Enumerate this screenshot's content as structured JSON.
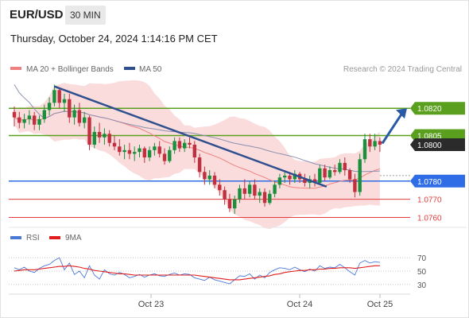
{
  "header": {
    "symbol": "EUR/USD",
    "timeframe": "30 MIN",
    "datetime": "Thursday, October 24, 2024 1:14:16 PM CET"
  },
  "legend": {
    "ma20_bb": "MA 20 + Bollinger Bands",
    "ma50": "MA 50",
    "credit": "Research © 2024 Trading Central"
  },
  "rsi_legend": {
    "rsi": "RSI",
    "ma9": "9MA"
  },
  "colors": {
    "support_resistance_green": "#5aa01e",
    "pivot_blue": "#2e6de6",
    "target_red": "#e03c3c",
    "candle_up": "#1a8f3c",
    "candle_down": "#c0303e",
    "ma50": "#2f4f8f",
    "bollinger": "#f5c0c0",
    "rsi_line": "#4a78d8",
    "rsi_ma": "#e01e1e",
    "arrow": "#2a5aa6"
  },
  "chart_data": {
    "type": "candlestick",
    "title": "EUR/USD",
    "timeframe": "30 MIN",
    "price_scale": {
      "min": 1.0755,
      "max": 1.0838
    },
    "x_ticks": [
      "Oct 23",
      "Oct 24",
      "Oct 25"
    ],
    "levels": [
      {
        "value": 1.082,
        "label": "1.0820",
        "kind": "resistance",
        "color": "#5aa01e"
      },
      {
        "value": 1.0805,
        "label": "1.0805",
        "kind": "resistance",
        "color": "#5aa01e"
      },
      {
        "value": 1.08,
        "label": "1.0800",
        "kind": "last_price",
        "color": "#2b2b2b"
      },
      {
        "value": 1.078,
        "label": "1.0780",
        "kind": "pivot",
        "color": "#2e6de6"
      },
      {
        "value": 1.077,
        "label": "1.0770",
        "kind": "support",
        "color": "#e03c3c"
      },
      {
        "value": 1.076,
        "label": "1.0760",
        "kind": "support",
        "color": "#e03c3c"
      }
    ],
    "candles": [
      [
        1.0818,
        1.0821,
        1.081,
        1.0815
      ],
      [
        1.0815,
        1.0818,
        1.0809,
        1.0812
      ],
      [
        1.0812,
        1.0817,
        1.0809,
        1.0814
      ],
      [
        1.0814,
        1.0819,
        1.0811,
        1.0816
      ],
      [
        1.0816,
        1.0818,
        1.0808,
        1.0811
      ],
      [
        1.0811,
        1.0816,
        1.0808,
        1.0814
      ],
      [
        1.0814,
        1.0822,
        1.0812,
        1.0819
      ],
      [
        1.0819,
        1.0826,
        1.0816,
        1.0823
      ],
      [
        1.0823,
        1.0833,
        1.0821,
        1.083
      ],
      [
        1.083,
        1.0831,
        1.082,
        1.0823
      ],
      [
        1.0823,
        1.0828,
        1.0818,
        1.0825
      ],
      [
        1.0825,
        1.0828,
        1.0812,
        1.0815
      ],
      [
        1.0815,
        1.0822,
        1.0811,
        1.0819
      ],
      [
        1.0819,
        1.0823,
        1.081,
        1.0812
      ],
      [
        1.0812,
        1.0818,
        1.0809,
        1.0815
      ],
      [
        1.0815,
        1.0816,
        1.0797,
        1.08
      ],
      [
        1.08,
        1.081,
        1.0798,
        1.0807
      ],
      [
        1.0807,
        1.0812,
        1.0801,
        1.0804
      ],
      [
        1.0804,
        1.0809,
        1.08,
        1.0806
      ],
      [
        1.0806,
        1.0808,
        1.0799,
        1.0801
      ],
      [
        1.0801,
        1.0805,
        1.0797,
        1.0799
      ],
      [
        1.0799,
        1.0803,
        1.0794,
        1.0796
      ],
      [
        1.0796,
        1.08,
        1.0792,
        1.0797
      ],
      [
        1.0797,
        1.0801,
        1.0792,
        1.0795
      ],
      [
        1.0795,
        1.0799,
        1.0791,
        1.0796
      ],
      [
        1.0796,
        1.08,
        1.0793,
        1.0798
      ],
      [
        1.0798,
        1.0799,
        1.079,
        1.0793
      ],
      [
        1.0793,
        1.0799,
        1.0791,
        1.0797
      ],
      [
        1.0797,
        1.0801,
        1.0794,
        1.0799
      ],
      [
        1.0799,
        1.0802,
        1.0793,
        1.0795
      ],
      [
        1.0795,
        1.0798,
        1.0789,
        1.0791
      ],
      [
        1.0791,
        1.0799,
        1.079,
        1.0797
      ],
      [
        1.0797,
        1.0804,
        1.0795,
        1.0802
      ],
      [
        1.0802,
        1.0804,
        1.0796,
        1.0798
      ],
      [
        1.0798,
        1.0803,
        1.0796,
        1.0801
      ],
      [
        1.0801,
        1.0804,
        1.0798,
        1.08
      ],
      [
        1.08,
        1.0802,
        1.079,
        1.0793
      ],
      [
        1.0793,
        1.0795,
        1.0782,
        1.0785
      ],
      [
        1.0785,
        1.0788,
        1.0778,
        1.0781
      ],
      [
        1.0781,
        1.0786,
        1.0778,
        1.0783
      ],
      [
        1.0783,
        1.0785,
        1.0776,
        1.0778
      ],
      [
        1.0778,
        1.0781,
        1.0772,
        1.0775
      ],
      [
        1.0775,
        1.0777,
        1.0767,
        1.077
      ],
      [
        1.077,
        1.0773,
        1.0763,
        1.0765
      ],
      [
        1.0765,
        1.0772,
        1.0762,
        1.077
      ],
      [
        1.077,
        1.0778,
        1.0768,
        1.0776
      ],
      [
        1.0776,
        1.0781,
        1.077,
        1.0773
      ],
      [
        1.0773,
        1.078,
        1.0771,
        1.0778
      ],
      [
        1.0778,
        1.0781,
        1.077,
        1.0772
      ],
      [
        1.0772,
        1.0776,
        1.0768,
        1.0774
      ],
      [
        1.0774,
        1.0776,
        1.0766,
        1.0768
      ],
      [
        1.0768,
        1.0775,
        1.0767,
        1.0773
      ],
      [
        1.0773,
        1.078,
        1.0771,
        1.0778
      ],
      [
        1.0778,
        1.0784,
        1.0776,
        1.0782
      ],
      [
        1.0782,
        1.0786,
        1.0779,
        1.0783
      ],
      [
        1.0783,
        1.0785,
        1.0778,
        1.0781
      ],
      [
        1.0781,
        1.0786,
        1.0779,
        1.0784
      ],
      [
        1.0784,
        1.0785,
        1.0779,
        1.0781
      ],
      [
        1.0781,
        1.0784,
        1.0777,
        1.0779
      ],
      [
        1.0779,
        1.0783,
        1.0776,
        1.0781
      ],
      [
        1.0781,
        1.0784,
        1.0777,
        1.0779
      ],
      [
        1.0779,
        1.0789,
        1.0778,
        1.0787
      ],
      [
        1.0787,
        1.0789,
        1.078,
        1.0782
      ],
      [
        1.0782,
        1.0788,
        1.0781,
        1.0786
      ],
      [
        1.0786,
        1.0789,
        1.0783,
        1.0785
      ],
      [
        1.0785,
        1.0792,
        1.0784,
        1.079
      ],
      [
        1.079,
        1.0793,
        1.0783,
        1.0786
      ],
      [
        1.0786,
        1.0787,
        1.0779,
        1.0781
      ],
      [
        1.0781,
        1.0784,
        1.0771,
        1.0774
      ],
      [
        1.0774,
        1.0795,
        1.0772,
        1.0792
      ],
      [
        1.0792,
        1.0806,
        1.079,
        1.0803
      ],
      [
        1.0803,
        1.0806,
        1.0796,
        1.0799
      ],
      [
        1.0799,
        1.0806,
        1.0797,
        1.0802
      ],
      [
        1.0802,
        1.0804,
        1.0796,
        1.08
      ]
    ],
    "series": [
      {
        "name": "MA 20 + Bollinger Bands"
      },
      {
        "name": "MA 50"
      },
      {
        "name": "RSI",
        "values": [
          55,
          52,
          56,
          50,
          48,
          54,
          58,
          60,
          66,
          70,
          52,
          62,
          45,
          50,
          40,
          58,
          44,
          38,
          52,
          46,
          44,
          48,
          45,
          40,
          42,
          45,
          41,
          44,
          46,
          43,
          42,
          45,
          47,
          44,
          46,
          45,
          40,
          38,
          36,
          41,
          37,
          35,
          33,
          31,
          37,
          43,
          42,
          46,
          38,
          44,
          40,
          48,
          52,
          55,
          54,
          52,
          56,
          52,
          49,
          53,
          50,
          58,
          54,
          56,
          55,
          60,
          55,
          49,
          44,
          62,
          66,
          62,
          64,
          63
        ]
      },
      {
        "name": "9MA",
        "values": [
          50,
          51,
          52,
          52,
          52,
          53,
          54,
          55,
          56,
          57,
          57,
          58,
          57,
          56,
          54,
          53,
          51,
          50,
          49,
          48,
          47,
          46,
          46,
          45,
          44,
          44,
          44,
          44,
          44,
          44,
          44,
          44,
          44,
          44,
          44,
          44,
          44,
          43,
          42,
          41,
          40,
          39,
          38,
          37,
          37,
          37,
          38,
          39,
          40,
          41,
          42,
          43,
          45,
          46,
          48,
          49,
          50,
          51,
          51,
          52,
          52,
          53,
          53,
          54,
          54,
          55,
          55,
          55,
          54,
          55,
          56,
          57,
          58,
          58
        ]
      }
    ],
    "trendlines": [
      {
        "from": [
          8,
          1.0832
        ],
        "to": [
          56,
          1.078
        ],
        "color": "#2f4f8f"
      }
    ],
    "projection": {
      "from_value": 1.0802,
      "to_value": 1.082,
      "label": "1.0820"
    },
    "rsi": {
      "ticks": [
        "70",
        "50",
        "30"
      ],
      "levels": [
        70,
        50,
        30
      ]
    }
  }
}
